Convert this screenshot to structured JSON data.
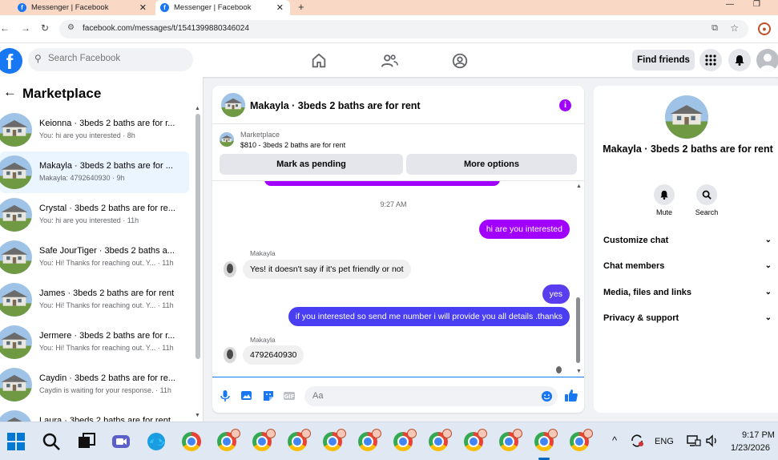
{
  "browser": {
    "tabs": [
      {
        "title": "Messenger | Facebook"
      },
      {
        "title": "Messenger | Facebook"
      }
    ],
    "url": "facebook.com/messages/t/1541399880346024"
  },
  "fb_header": {
    "search_placeholder": "Search Facebook",
    "find_friends": "Find friends"
  },
  "left": {
    "title": "Marketplace",
    "conversations": [
      {
        "name": "Keionna · 3beds 2 baths are for r...",
        "preview": "You: hi are you interested · 8h",
        "active": false
      },
      {
        "name": "Makayla · 3beds 2 baths are for ...",
        "preview": "Makayla: 4792640930 · 9h",
        "active": true
      },
      {
        "name": "Crystal · 3beds 2 baths are for re...",
        "preview": "You: hi are you interested · 11h",
        "active": false
      },
      {
        "name": "Safe JourTiger · 3beds 2 baths a...",
        "preview": "You: Hi! Thanks for reaching out. Y... · 11h",
        "active": false
      },
      {
        "name": "James · 3beds 2 baths are for rent",
        "preview": "You: Hi! Thanks for reaching out. Y... · 11h",
        "active": false
      },
      {
        "name": "Jermere · 3beds 2 baths are for r...",
        "preview": "You: Hi! Thanks for reaching out. Y... · 11h",
        "active": false
      },
      {
        "name": "Caydin · 3beds 2 baths are for re...",
        "preview": "Caydin is waiting for your response. · 11h",
        "active": false
      },
      {
        "name": "Laura · 3beds 2 baths are for rent",
        "preview": "",
        "active": false
      }
    ]
  },
  "chat": {
    "title": "Makayla · 3beds 2 baths are for rent",
    "marketplace_label": "Marketplace",
    "listing": "$810 - 3beds 2 baths are for rent",
    "mark_pending": "Mark as pending",
    "more_options": "More options",
    "timestamp": "9:27 AM",
    "messages": [
      {
        "from": "me",
        "text": "hi are you interested"
      },
      {
        "from": "them",
        "sender": "Makayla",
        "text": "Yes!  it doesn't say if it's pet friendly or not"
      },
      {
        "from": "me",
        "text": "yes"
      },
      {
        "from": "me",
        "text": "if you interested so send me number i will provide you all details .thanks"
      },
      {
        "from": "them",
        "sender": "Makayla",
        "text": "4792640930"
      }
    ],
    "composer_placeholder": "Aa"
  },
  "right": {
    "title": "Makayla · 3beds 2 baths are for rent",
    "actions": [
      {
        "label": "Mute"
      },
      {
        "label": "Search"
      }
    ],
    "sections": [
      "Customize chat",
      "Chat members",
      "Media, files and links",
      "Privacy & support"
    ]
  },
  "taskbar": {
    "lang": "ENG",
    "time": "9:17 PM",
    "date": "1/23/2026"
  },
  "colors": {
    "fb_blue": "#1877f2",
    "bubble_purple": "#a100ff",
    "bubble_blue": "#4a3ef2",
    "active_row": "#ebf5ff"
  }
}
